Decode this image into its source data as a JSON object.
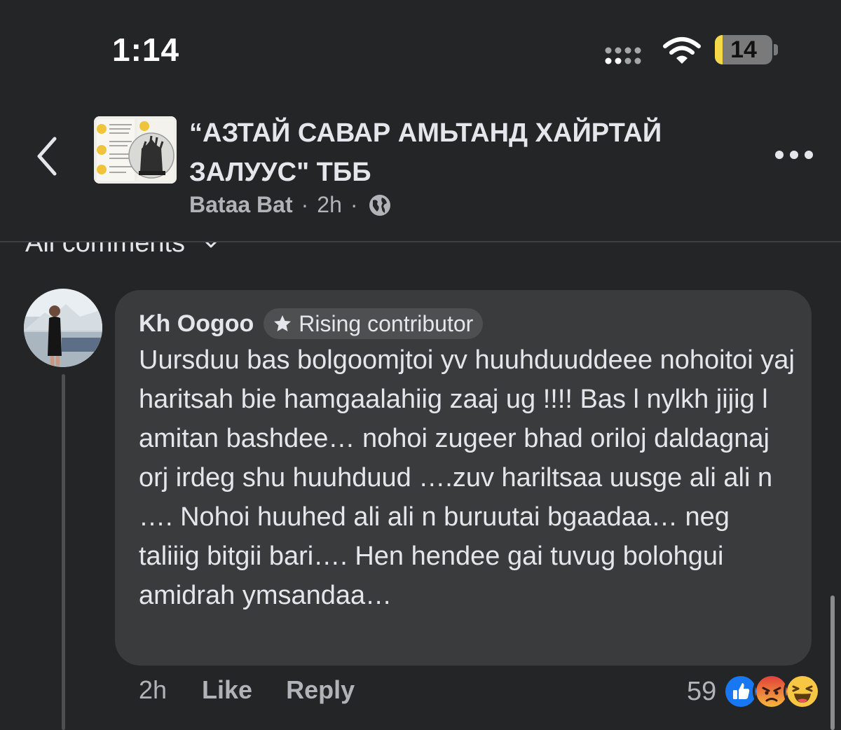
{
  "status_bar": {
    "time": "1:14",
    "battery": "14",
    "battery_fraction": 0.14
  },
  "header": {
    "group_title": "“АЗТАЙ САВАР АМЬТАНД ХАЙРТАЙ ЗАЛУУС\" ТББ",
    "author": "Bataa Bat",
    "separator": "·",
    "time": "2h",
    "privacy_icon": "globe-icon",
    "back_icon": "chevron-left-icon",
    "more_icon": "more-horizontal-icon"
  },
  "comments_filter": {
    "label": "All comments",
    "icon": "chevron-down-icon"
  },
  "comment": {
    "author": "Kh Oogoo",
    "badge": "Rising contributor",
    "badge_icon": "star-icon",
    "text": "Uursduu bas bolgoomjtoi yv huuhduuddeee nohoitoi yaj haritsah bie hamgaalahiig zaaj ug !!!! Bas l nylkh jijig l amitan bashdee… nohoi zugeer bhad oriloj daldagnaj orj irdeg shu huuhduud ….zuv hariltsaa uusge ali ali n …. Nohoi huuhed ali ali n buruutai bgaadaa… neg taliiig bitgii bari…. Hen hendee gai tuvug bolohgui amidrah ymsandaa…",
    "time": "2h",
    "like_label": "Like",
    "reply_label": "Reply",
    "reaction_count": "59",
    "reactions": [
      "like",
      "angry",
      "haha"
    ]
  },
  "colors": {
    "background": "#242526",
    "bubble": "#3a3b3c",
    "primary_text": "#e4e6eb",
    "secondary_text": "#b0b3b8",
    "like_blue": "#1877f2",
    "battery_yellow": "#f6d94a"
  }
}
